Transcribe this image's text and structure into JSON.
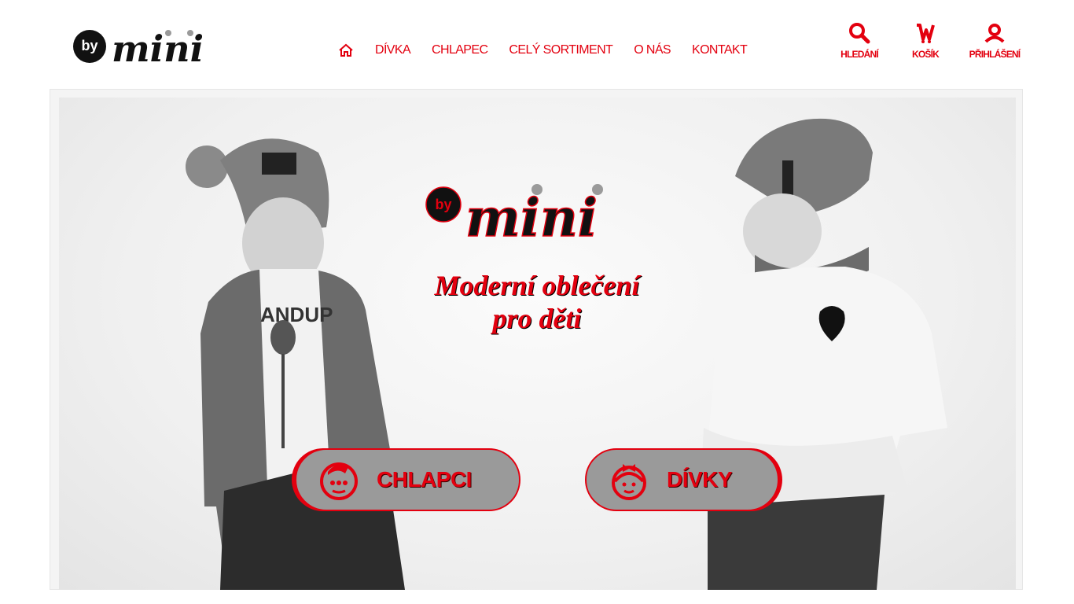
{
  "brand": {
    "logo_by": "by",
    "logo_mini": "mini"
  },
  "nav": {
    "items": [
      {
        "label": "DÍVKA"
      },
      {
        "label": "CHLAPEC"
      },
      {
        "label": "CELÝ SORTIMENT"
      },
      {
        "label": "O NÁS"
      },
      {
        "label": "KONTAKT"
      }
    ]
  },
  "actions": {
    "search": {
      "label": "HLEDÁNÍ",
      "icon": "search-icon"
    },
    "cart": {
      "label": "KOŠÍK",
      "icon": "cart-icon"
    },
    "login": {
      "label": "PŘIHLÁŠENÍ",
      "icon": "user-icon"
    }
  },
  "hero": {
    "logo_by": "by",
    "logo_mini": "mini",
    "tagline_line1": "Moderní oblečení",
    "tagline_line2": "pro děti",
    "cta_boys": {
      "label": "CHLAPCI",
      "icon": "boy-face-icon"
    },
    "cta_girls": {
      "label": "DÍVKY",
      "icon": "girl-face-icon"
    }
  },
  "colors": {
    "accent": "#e3000f",
    "button_bg": "#9a9a9a",
    "text_dark": "#111111"
  }
}
